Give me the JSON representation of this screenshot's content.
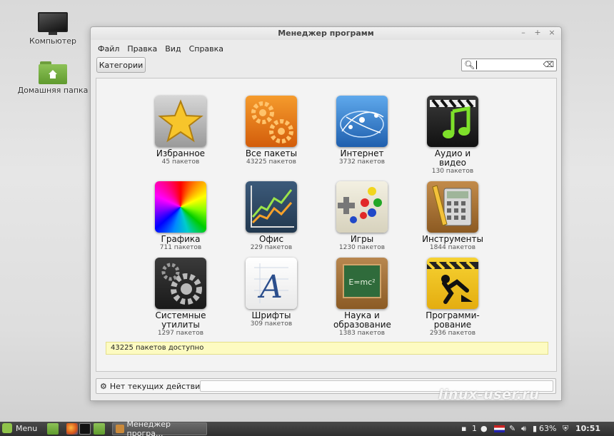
{
  "desktop": {
    "computer_label": "Компьютер",
    "home_label": "Домашняя папка"
  },
  "window": {
    "title": "Менеджер программ",
    "controls": {
      "minimize": "–",
      "maximize": "+",
      "close": "×"
    },
    "menu": [
      "Файл",
      "Правка",
      "Вид",
      "Справка"
    ],
    "categories_button": "Категории",
    "search": {
      "value": "",
      "placeholder": ""
    }
  },
  "categories": [
    {
      "name": "Избранное",
      "count": "45 пакетов",
      "icon": "star-icon"
    },
    {
      "name": "Все пакеты",
      "count": "43225 пакетов",
      "icon": "gears-icon"
    },
    {
      "name": "Интернет",
      "count": "3732 пакетов",
      "icon": "globe-network-icon"
    },
    {
      "name": "Аудио и видео",
      "count": "130 пакетов",
      "icon": "clapper-music-icon"
    },
    {
      "name": "Графика",
      "count": "711 пакетов",
      "icon": "color-wheel-icon"
    },
    {
      "name": "Офис",
      "count": "229 пакетов",
      "icon": "line-chart-icon"
    },
    {
      "name": "Игры",
      "count": "1230 пакетов",
      "icon": "gamepad-icon"
    },
    {
      "name": "Инструменты",
      "count": "1844 пакетов",
      "icon": "calculator-icon"
    },
    {
      "name": "Системные утилиты",
      "count": "1297 пакетов",
      "icon": "system-gear-icon"
    },
    {
      "name": "Шрифты",
      "count": "309 пакетов",
      "icon": "font-icon"
    },
    {
      "name": "Наука и образование",
      "count": "1383 пакетов",
      "icon": "chalkboard-icon"
    },
    {
      "name": "Программи- рование",
      "count": "2936 пакетов",
      "icon": "construction-icon"
    }
  ],
  "available_text": "43225 пакетов доступно",
  "status_text": "Нет текущих действий",
  "watermark": "linux-user.ru",
  "taskbar": {
    "menu_label": "Menu",
    "task_label": "Менеджер програ...",
    "workspace": "1",
    "battery": "63%",
    "clock": "10:51"
  }
}
